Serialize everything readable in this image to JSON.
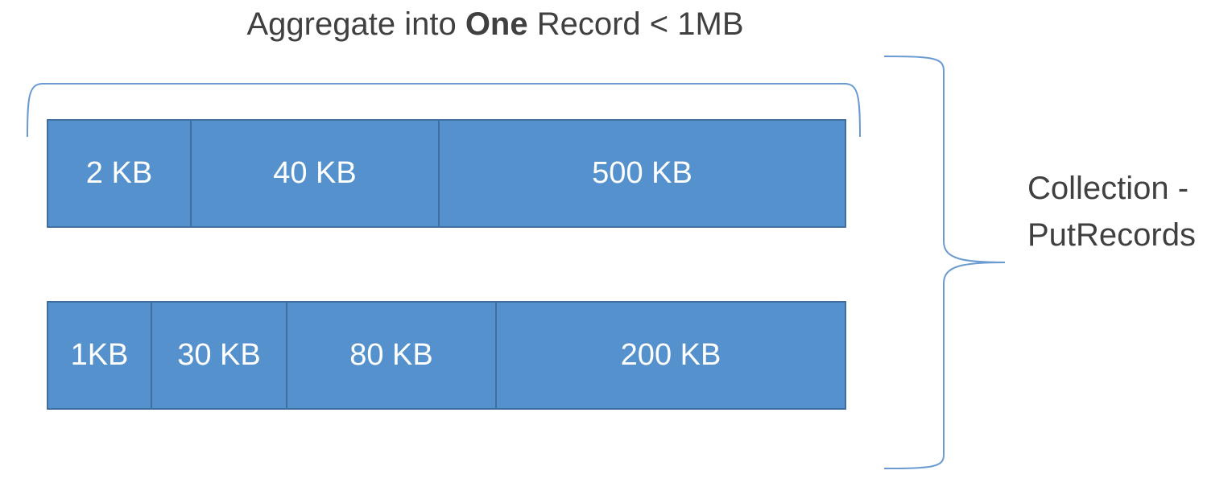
{
  "title": {
    "prefix": "Aggregate into ",
    "bold": "One",
    "suffix": " Record < 1MB"
  },
  "rows": [
    {
      "records": [
        "2 KB",
        "40 KB",
        "500 KB"
      ]
    },
    {
      "records": [
        "1KB",
        "30 KB",
        "80 KB",
        "200 KB"
      ]
    }
  ],
  "side_label": {
    "line1": "Collection -",
    "line2": "PutRecords"
  },
  "colors": {
    "block_fill": "#5592cd",
    "block_border": "#3e6fa0",
    "bracket_stroke": "#6a9bd0",
    "text": "#404040"
  }
}
